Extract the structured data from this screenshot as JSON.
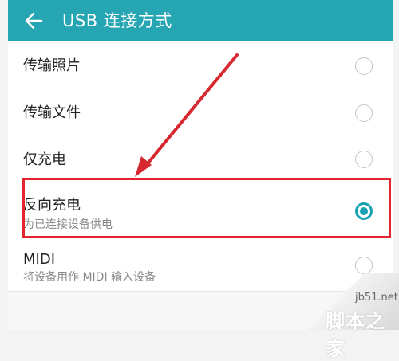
{
  "header": {
    "title": "USB 连接方式",
    "back_icon": "arrow-left-icon"
  },
  "options": [
    {
      "label": "传输照片",
      "sublabel": "",
      "selected": false
    },
    {
      "label": "传输文件",
      "sublabel": "",
      "selected": false
    },
    {
      "label": "仅充电",
      "sublabel": "",
      "selected": false
    },
    {
      "label": "反向充电",
      "sublabel": "为已连接设备供电",
      "selected": true
    },
    {
      "label": "MIDI",
      "sublabel": "将设备用作 MIDI 输入设备",
      "selected": false
    }
  ],
  "watermark": {
    "url": "jb51.net",
    "brand": "脚本之家"
  },
  "colors": {
    "header_bg": "#26a6b3",
    "radio_selected": "#17a2b3",
    "highlight": "#e2252f",
    "arrow": "#d7282f"
  }
}
